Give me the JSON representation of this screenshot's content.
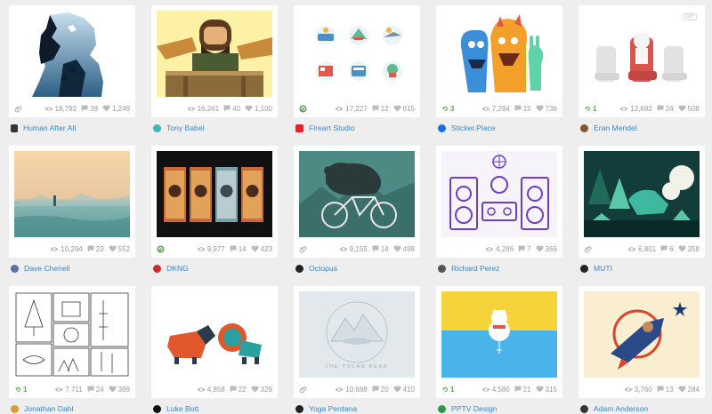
{
  "shots": [
    {
      "user": "Human After All",
      "views": "18,792",
      "comments": "39",
      "likes": "1,249",
      "lead": "attachment",
      "avatar_color": "#333333",
      "icon": "human-after-all-bear-art"
    },
    {
      "user": "Tony Babel",
      "views": "16,241",
      "comments": "40",
      "likes": "1,100",
      "lead": "",
      "avatar_color": "#3fb3b0",
      "icon": "dwarf-character-art"
    },
    {
      "user": "Fireart Studio",
      "views": "17,227",
      "comments": "12",
      "likes": "615",
      "lead": "rebound",
      "avatar_color": "#e0242b",
      "icon": "travel-icons-set"
    },
    {
      "user": "Sticker.Place",
      "views": "7,284",
      "comments": "15",
      "likes": "736",
      "lead": "rebound",
      "lead_count": "3",
      "avatar_color": "#1a6fe6",
      "icon": "monster-characters-art"
    },
    {
      "user": "Eran Mendel",
      "views": "12,692",
      "comments": "24",
      "likes": "508",
      "lead": "rebound",
      "lead_count": "1",
      "avatar_color": "#7a5a3a",
      "icon": "bear-airplane-seat-art",
      "tag": "GIF"
    },
    {
      "user": "Dave Chenell",
      "views": "10,294",
      "comments": "23",
      "likes": "552",
      "lead": "",
      "avatar_color": "#5a6fa5",
      "icon": "sea-landscape-art"
    },
    {
      "user": "DKNG",
      "views": "9,977",
      "comments": "14",
      "likes": "423",
      "lead": "rebound",
      "avatar_color": "#d12a2a",
      "icon": "tiger-posters-art"
    },
    {
      "user": "Octopus",
      "views": "9,155",
      "comments": "14",
      "likes": "498",
      "lead": "attachment",
      "avatar_color": "#222222",
      "icon": "bear-bicycle-art"
    },
    {
      "user": "Richard Perez",
      "views": "4,286",
      "comments": "7",
      "likes": "356",
      "lead": "",
      "avatar_color": "#555555",
      "icon": "dj-speakers-art"
    },
    {
      "user": "MUTI",
      "views": "6,801",
      "comments": "6",
      "likes": "358",
      "lead": "attachment",
      "avatar_color": "#222222",
      "icon": "forest-dinosaur-art"
    },
    {
      "user": "Jonathan Dahl",
      "views": "7,711",
      "comments": "24",
      "likes": "389",
      "lead": "rebound",
      "lead_count": "1",
      "avatar_color": "#d89b3a",
      "icon": "line-icons-grid-art"
    },
    {
      "user": "Luke Bott",
      "views": "4,858",
      "comments": "22",
      "likes": "329",
      "lead": "",
      "avatar_color": "#111111",
      "icon": "bear-lion-art"
    },
    {
      "user": "Yoga Perdana",
      "views": "10,688",
      "comments": "20",
      "likes": "410",
      "lead": "attachment",
      "avatar_color": "#222222",
      "icon": "polar-bear-badge-art",
      "caption": "THE POLAR BEAR"
    },
    {
      "user": "PPTV Design",
      "views": "4,580",
      "comments": "21",
      "likes": "315",
      "lead": "rebound",
      "lead_count": "1",
      "avatar_color": "#2a9a4a",
      "icon": "polar-bear-fishing-art"
    },
    {
      "user": "Adam Anderson",
      "views": "3,760",
      "comments": "13",
      "likes": "284",
      "lead": "",
      "avatar_color": "#333333",
      "icon": "bear-rocket-art"
    }
  ],
  "colors": {
    "link": "#3a86c8",
    "muted": "#999999",
    "rebound": "#5fa55a",
    "background": "#eeeeee"
  }
}
